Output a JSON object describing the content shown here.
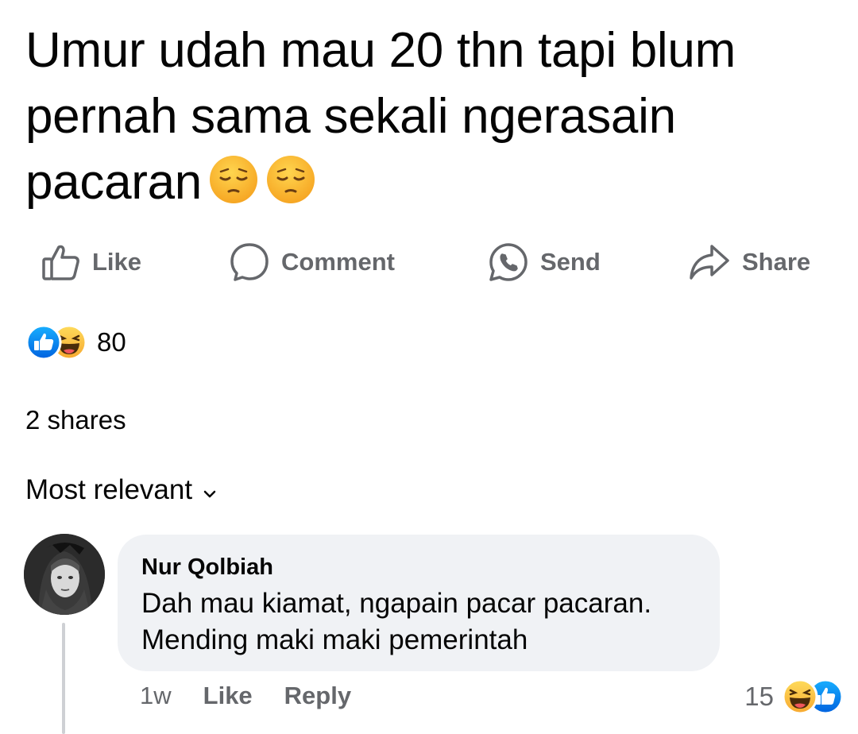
{
  "post": {
    "text": "Umur udah mau 20 thn tapi blum pernah sama sekali ngerasain pacaran",
    "emojis": [
      "pensive-face",
      "pensive-face"
    ]
  },
  "actions": {
    "like_label": "Like",
    "comment_label": "Comment",
    "send_label": "Send",
    "share_label": "Share"
  },
  "reactions": {
    "types": [
      "like",
      "haha"
    ],
    "count": "80"
  },
  "shares_text": "2 shares",
  "sort": {
    "label": "Most relevant"
  },
  "comment": {
    "author": "Nur Qolbiah",
    "text": "Dah mau kiamat, ngapain pacar pacaran. Mending maki maki pemerintah",
    "time": "1w",
    "like_label": "Like",
    "reply_label": "Reply",
    "reaction_count": "15",
    "reaction_types": [
      "haha",
      "like"
    ]
  },
  "colors": {
    "text_primary": "#050505",
    "text_secondary": "#65676b",
    "bubble_bg": "#f0f2f5",
    "like_blue": "#1b74e4",
    "haha_yellow": "#f7b928"
  }
}
